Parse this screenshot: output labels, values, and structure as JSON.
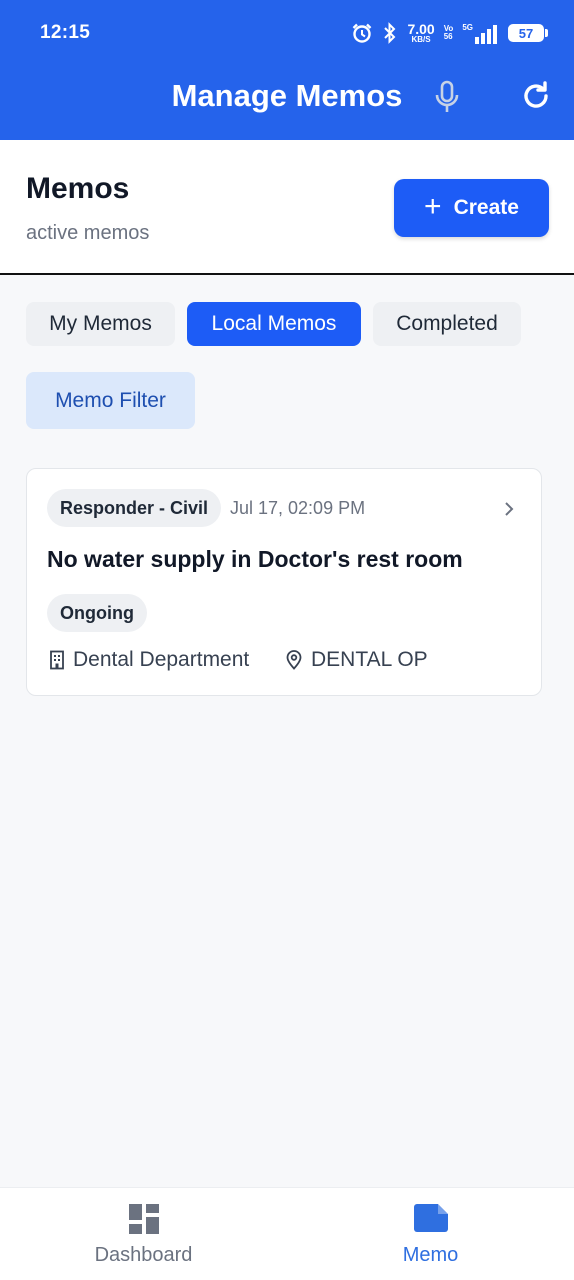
{
  "status_bar": {
    "time": "12:15",
    "speed_value": "7.00",
    "speed_unit": "KB/S",
    "volte_top": "Vo",
    "volte_bottom": "56",
    "network": "5G",
    "battery": "57"
  },
  "app_bar": {
    "title": "Manage Memos",
    "icons": [
      "mic-icon",
      "refresh-icon"
    ]
  },
  "header": {
    "title": "Memos",
    "subtitle": "active memos",
    "create_label": "Create"
  },
  "tabs": [
    {
      "label": "My Memos",
      "active": false
    },
    {
      "label": "Local Memos",
      "active": true
    },
    {
      "label": "Completed",
      "active": false
    }
  ],
  "filter_label": "Memo Filter",
  "memos": [
    {
      "category": "Responder - Civil",
      "datetime": "Jul 17, 02:09 PM",
      "title": "No water supply in Doctor's rest room",
      "status": "Ongoing",
      "department": "Dental Department",
      "location": "DENTAL OP"
    }
  ],
  "bottom_nav": [
    {
      "label": "Dashboard",
      "icon": "dashboard-icon",
      "active": false
    },
    {
      "label": "Memo",
      "icon": "memo-icon",
      "active": true
    }
  ],
  "colors": {
    "primary": "#2563eb",
    "button": "#1d5cf6",
    "filter_bg": "#dbe8fb",
    "nav_active": "#2f6fe0",
    "nav_inactive": "#6b7280"
  }
}
